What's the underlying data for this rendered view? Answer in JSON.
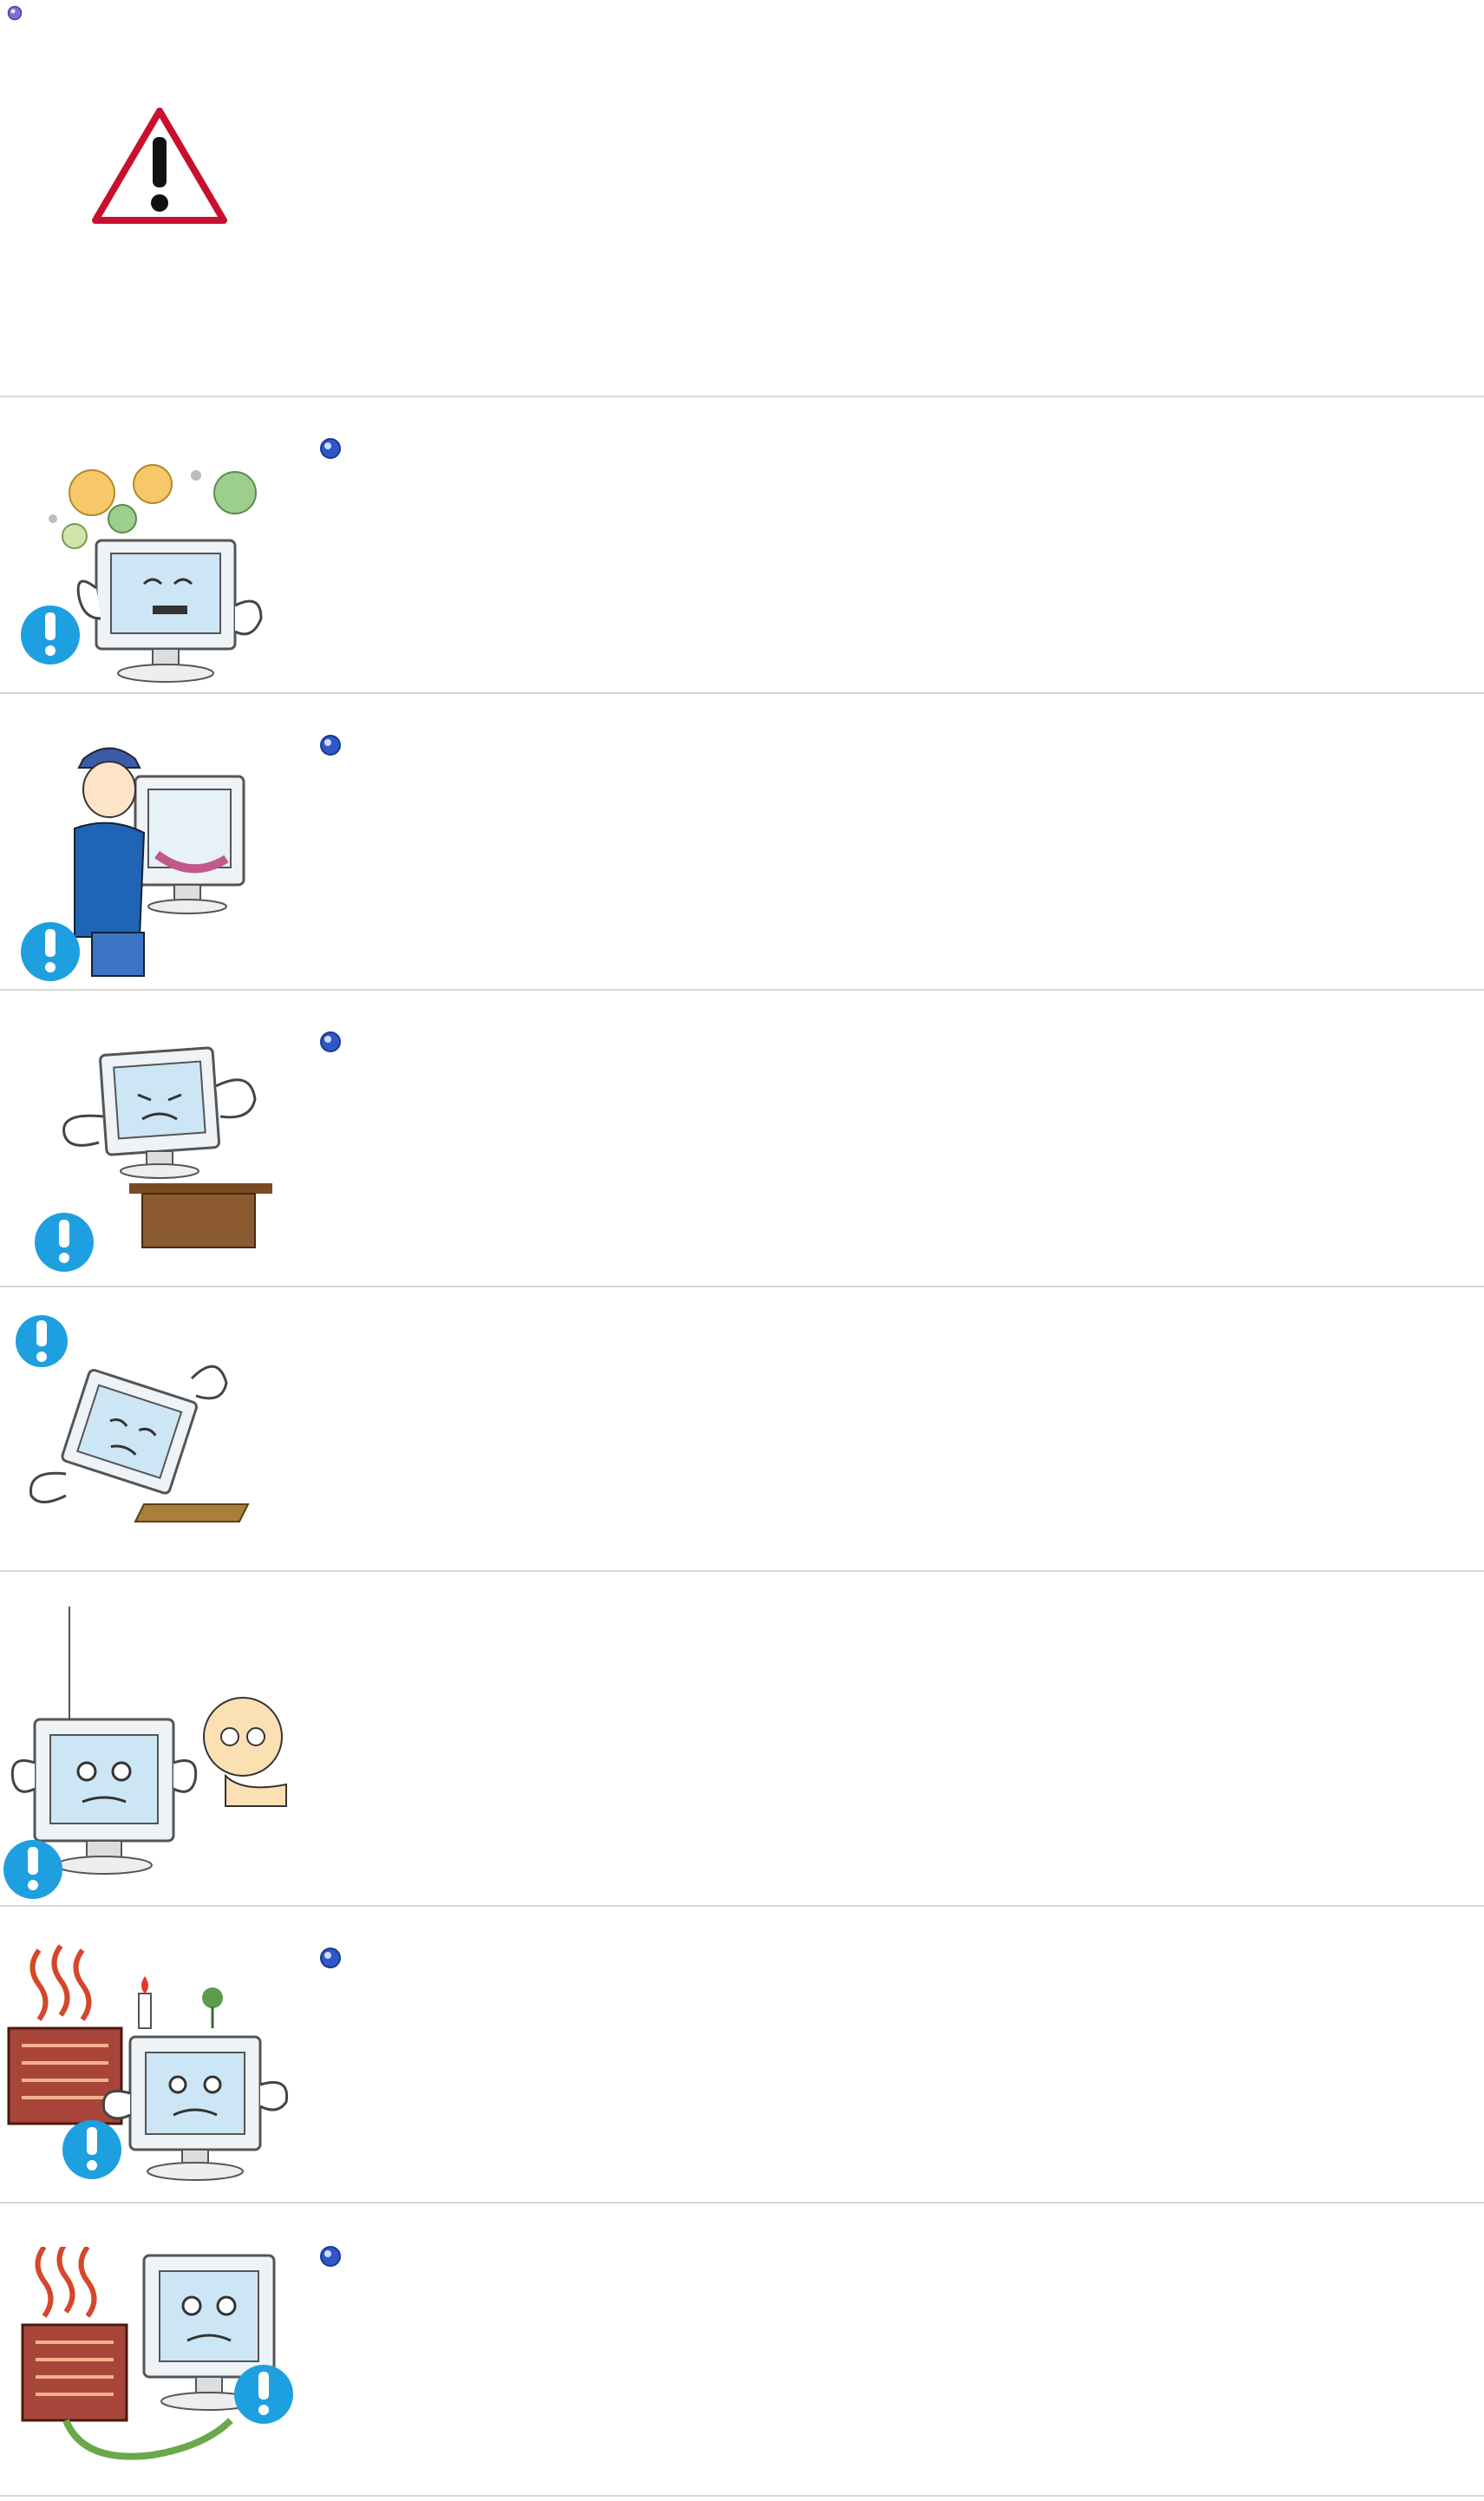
{
  "section_title": "",
  "warning_icon": "warning-triangle-icon",
  "items": [
    {
      "id": 1,
      "scene": "monitor-smoke-flowers",
      "text": ""
    },
    {
      "id": 2,
      "scene": "technician-with-monitor",
      "text": ""
    },
    {
      "id": 3,
      "scene": "monitor-on-small-stand",
      "text": ""
    },
    {
      "id": 4,
      "scene": "monitor-tilted-falling",
      "text": ""
    },
    {
      "id": 5,
      "scene": "monitor-antenna-baby",
      "text": ""
    },
    {
      "id": 6,
      "scene": "heater-candle-monitor",
      "text": ""
    },
    {
      "id": 7,
      "scene": "heater-cord-monitor",
      "text": ""
    }
  ],
  "colors": {
    "divider": "#d7d7d7",
    "bullet_blue": "#2f57c8",
    "caution_blue": "#1ea0e0",
    "warning_red": "#c8102e"
  }
}
